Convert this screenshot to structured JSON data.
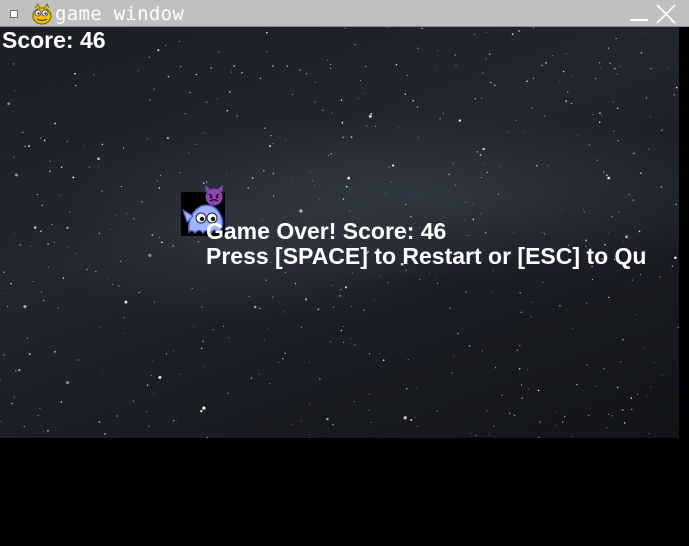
{
  "window": {
    "title": "game window",
    "icons": {
      "menu": "window-menu-icon",
      "app": "pygame-snake-icon",
      "minimize": "minimize-icon",
      "close": "close-icon"
    }
  },
  "hud": {
    "score_text": "Score: 46"
  },
  "game_over": {
    "title": "Game Over! Score: 46",
    "instructions": "Press [SPACE] to Restart or [ESC] to Qu"
  },
  "sprites": {
    "player": "ghost-player-sprite",
    "enemy": "devil-emoji-sprite"
  },
  "colors": {
    "titlebar": "#c0c0c0",
    "text": "#ffffff",
    "background": "#000000",
    "enemy": "#8e44ad"
  }
}
